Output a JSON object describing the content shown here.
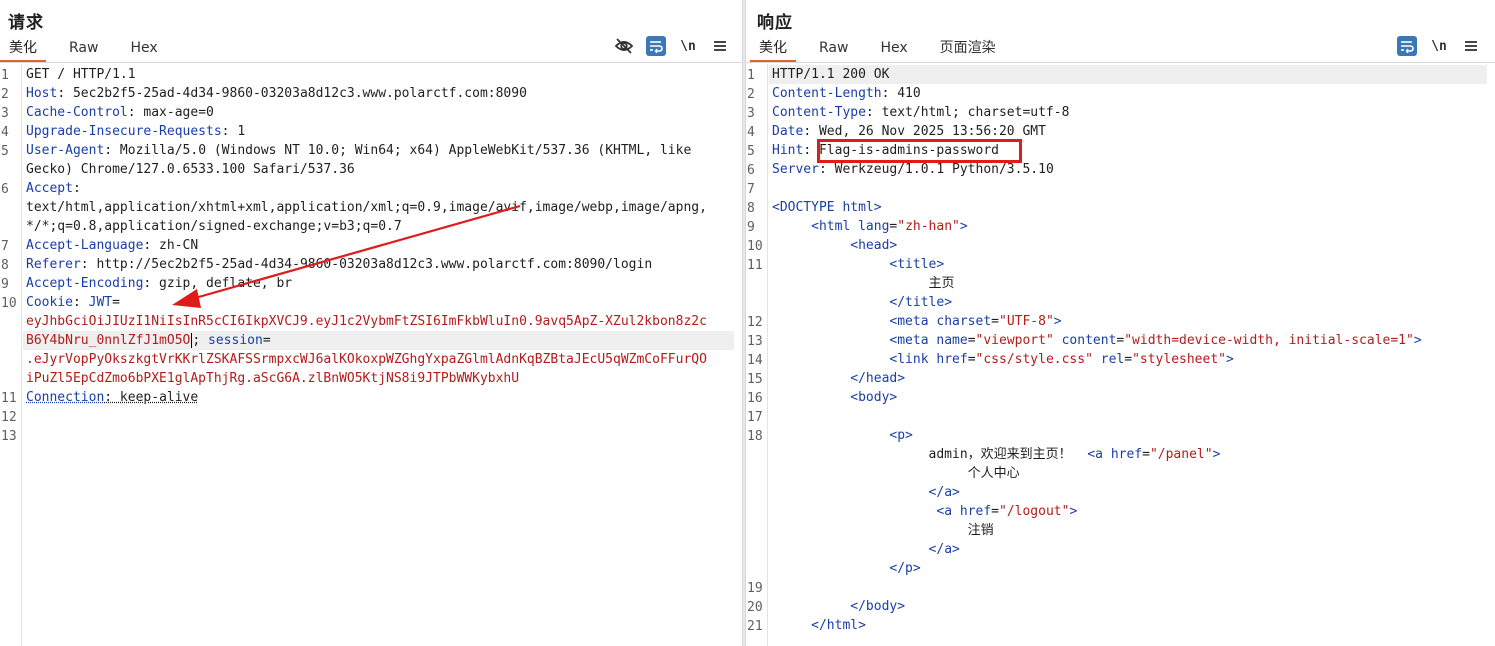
{
  "request": {
    "title": "请求",
    "tabs": [
      "美化",
      "Raw",
      "Hex"
    ],
    "newline_label": "\\n",
    "lines": [
      {
        "n": "1",
        "parts": [
          {
            "t": "GET / HTTP/1.1",
            "c": ""
          }
        ]
      },
      {
        "n": "2",
        "parts": [
          {
            "t": "Host",
            "c": "hn"
          },
          {
            "t": ": 5ec2b2f5-25ad-4d34-9860-03203a8d12c3.www.polarctf.com:8090",
            "c": ""
          }
        ]
      },
      {
        "n": "3",
        "parts": [
          {
            "t": "Cache-Control",
            "c": "hn"
          },
          {
            "t": ": max-age=0",
            "c": ""
          }
        ]
      },
      {
        "n": "4",
        "parts": [
          {
            "t": "Upgrade-Insecure-Requests",
            "c": "hn"
          },
          {
            "t": ": 1",
            "c": ""
          }
        ]
      },
      {
        "n": "5",
        "parts": [
          {
            "t": "User-Agent",
            "c": "hn"
          },
          {
            "t": ": Mozilla/5.0 (Windows NT 10.0; Win64; x64) AppleWebKit/537.36 (KHTML, like",
            "c": ""
          }
        ]
      },
      {
        "n": "",
        "parts": [
          {
            "t": "Gecko) Chrome/127.0.6533.100 Safari/537.36",
            "c": ""
          }
        ]
      },
      {
        "n": "6",
        "parts": [
          {
            "t": "Accept",
            "c": "hn"
          },
          {
            "t": ":",
            "c": ""
          }
        ]
      },
      {
        "n": "",
        "parts": [
          {
            "t": "text/html,application/xhtml+xml,application/xml;q=0.9,image/avif,image/webp,image/apng,",
            "c": ""
          }
        ]
      },
      {
        "n": "",
        "parts": [
          {
            "t": "*/*;q=0.8,application/signed-exchange;v=b3;q=0.7",
            "c": ""
          }
        ]
      },
      {
        "n": "7",
        "parts": [
          {
            "t": "Accept-Language",
            "c": "hn"
          },
          {
            "t": ": zh-CN",
            "c": ""
          }
        ]
      },
      {
        "n": "8",
        "parts": [
          {
            "t": "Referer",
            "c": "hn"
          },
          {
            "t": ": http://5ec2b2f5-25ad-4d34-9860-03203a8d12c3.www.polarctf.com:8090/login",
            "c": ""
          }
        ]
      },
      {
        "n": "9",
        "parts": [
          {
            "t": "Accept-Encoding",
            "c": "hn"
          },
          {
            "t": ": gzip, deflate, br",
            "c": ""
          }
        ]
      },
      {
        "n": "10",
        "parts": [
          {
            "t": "Cookie",
            "c": "hn"
          },
          {
            "t": ": ",
            "c": ""
          },
          {
            "t": "JWT",
            "c": "hn"
          },
          {
            "t": "=",
            "c": ""
          }
        ]
      },
      {
        "n": "",
        "parts": [
          {
            "t": "eyJhbGciOiJIUzI1NiIsInR5cCI6IkpXVCJ9.eyJ1c2VybmFtZSI6ImFkbWluIn0.9avq5ApZ-XZul2kbon8z2c",
            "c": "rv"
          }
        ]
      },
      {
        "n": "",
        "hl": true,
        "parts": [
          {
            "t": "B6Y4bNru_0nnlZfJ1mO5O",
            "c": "rv"
          },
          {
            "t": "",
            "c": "cursor"
          },
          {
            "t": "; ",
            "c": ""
          },
          {
            "t": "session",
            "c": "hn"
          },
          {
            "t": "=",
            "c": ""
          }
        ]
      },
      {
        "n": "",
        "parts": [
          {
            "t": ".eJyrVopPyOkszkgtVrKKrlZSKAFSSrmpxcWJ6alKOkoxpWZGhgYxpaZGlmlAdnKqBZBtaJEcU5qWZmCoFFurQO",
            "c": "rv"
          }
        ]
      },
      {
        "n": "",
        "parts": [
          {
            "t": "iPuZl5EpCdZmo6bPXE1glApThjRg.aScG6A.zlBnWO5KtjNS8i9JTPbWWKybxhU",
            "c": "rv"
          }
        ]
      },
      {
        "n": "11",
        "parts": [
          {
            "t": "Connection",
            "c": "hn underline"
          },
          {
            "t": ": keep-alive",
            "c": "underline"
          }
        ]
      },
      {
        "n": "12",
        "parts": []
      },
      {
        "n": "13",
        "parts": []
      }
    ]
  },
  "response": {
    "title": "响应",
    "tabs": [
      "美化",
      "Raw",
      "Hex",
      "页面渲染"
    ],
    "newline_label": "\\n",
    "lines": [
      {
        "n": "1",
        "hl": true,
        "parts": [
          {
            "t": "HTTP/1.1 200 OK",
            "c": ""
          }
        ]
      },
      {
        "n": "2",
        "parts": [
          {
            "t": "Content-Length",
            "c": "hn"
          },
          {
            "t": ": 410",
            "c": ""
          }
        ]
      },
      {
        "n": "3",
        "parts": [
          {
            "t": "Content-Type",
            "c": "hn"
          },
          {
            "t": ": text/html; charset=utf-8",
            "c": ""
          }
        ]
      },
      {
        "n": "4",
        "parts": [
          {
            "t": "Date",
            "c": "hn"
          },
          {
            "t": ": Wed, 26 Nov 2025 13:56:20 GMT",
            "c": ""
          }
        ]
      },
      {
        "n": "5",
        "parts": [
          {
            "t": "Hint",
            "c": "hn"
          },
          {
            "t": ": Flag-is-admins-password",
            "c": ""
          }
        ]
      },
      {
        "n": "6",
        "parts": [
          {
            "t": "Server",
            "c": "hn"
          },
          {
            "t": ": Werkzeug/1.0.1 Python/3.5.10",
            "c": ""
          }
        ]
      },
      {
        "n": "7",
        "parts": []
      },
      {
        "n": "8",
        "parts": [
          {
            "t": "<DOCTYPE html>",
            "c": "tag"
          }
        ]
      },
      {
        "n": "9",
        "parts": [
          {
            "t": "     ",
            "c": ""
          },
          {
            "t": "<html ",
            "c": "tag"
          },
          {
            "t": "lang",
            "c": "attr"
          },
          {
            "t": "=",
            "c": ""
          },
          {
            "t": "\"zh-han\"",
            "c": "str"
          },
          {
            "t": ">",
            "c": "tag"
          }
        ]
      },
      {
        "n": "10",
        "parts": [
          {
            "t": "          ",
            "c": ""
          },
          {
            "t": "<head>",
            "c": "tag"
          }
        ]
      },
      {
        "n": "11",
        "parts": [
          {
            "t": "               ",
            "c": ""
          },
          {
            "t": "<title>",
            "c": "tag"
          }
        ]
      },
      {
        "n": "",
        "parts": [
          {
            "t": "                    主页",
            "c": ""
          }
        ]
      },
      {
        "n": "",
        "parts": [
          {
            "t": "               ",
            "c": ""
          },
          {
            "t": "</title>",
            "c": "tag"
          }
        ]
      },
      {
        "n": "12",
        "parts": [
          {
            "t": "               ",
            "c": ""
          },
          {
            "t": "<meta ",
            "c": "tag"
          },
          {
            "t": "charset",
            "c": "attr"
          },
          {
            "t": "=",
            "c": ""
          },
          {
            "t": "\"UTF-8\"",
            "c": "str"
          },
          {
            "t": ">",
            "c": "tag"
          }
        ]
      },
      {
        "n": "13",
        "parts": [
          {
            "t": "               ",
            "c": ""
          },
          {
            "t": "<meta ",
            "c": "tag"
          },
          {
            "t": "name",
            "c": "attr"
          },
          {
            "t": "=",
            "c": ""
          },
          {
            "t": "\"viewport\" ",
            "c": "str"
          },
          {
            "t": "content",
            "c": "attr"
          },
          {
            "t": "=",
            "c": ""
          },
          {
            "t": "\"width=device-width, initial-scale=1\"",
            "c": "str"
          },
          {
            "t": ">",
            "c": "tag"
          }
        ]
      },
      {
        "n": "14",
        "parts": [
          {
            "t": "               ",
            "c": ""
          },
          {
            "t": "<link ",
            "c": "tag"
          },
          {
            "t": "href",
            "c": "attr"
          },
          {
            "t": "=",
            "c": ""
          },
          {
            "t": "\"css/style.css\" ",
            "c": "str"
          },
          {
            "t": "rel",
            "c": "attr"
          },
          {
            "t": "=",
            "c": ""
          },
          {
            "t": "\"stylesheet\"",
            "c": "str"
          },
          {
            "t": ">",
            "c": "tag"
          }
        ]
      },
      {
        "n": "15",
        "parts": [
          {
            "t": "          ",
            "c": ""
          },
          {
            "t": "</head>",
            "c": "tag"
          }
        ]
      },
      {
        "n": "16",
        "parts": [
          {
            "t": "          ",
            "c": ""
          },
          {
            "t": "<body>",
            "c": "tag"
          }
        ]
      },
      {
        "n": "17",
        "parts": []
      },
      {
        "n": "18",
        "parts": [
          {
            "t": "               ",
            "c": ""
          },
          {
            "t": "<p>",
            "c": "tag"
          }
        ]
      },
      {
        "n": "",
        "parts": [
          {
            "t": "                    admin，欢迎来到主页！  ",
            "c": ""
          },
          {
            "t": "<a ",
            "c": "tag"
          },
          {
            "t": "href",
            "c": "attr"
          },
          {
            "t": "=",
            "c": ""
          },
          {
            "t": "\"/panel\"",
            "c": "str"
          },
          {
            "t": ">",
            "c": "tag"
          }
        ]
      },
      {
        "n": "",
        "parts": [
          {
            "t": "                         个人中心",
            "c": ""
          }
        ]
      },
      {
        "n": "",
        "parts": [
          {
            "t": "                    ",
            "c": ""
          },
          {
            "t": "</a>",
            "c": "tag"
          }
        ]
      },
      {
        "n": "",
        "parts": [
          {
            "t": "                     ",
            "c": ""
          },
          {
            "t": "<a ",
            "c": "tag"
          },
          {
            "t": "href",
            "c": "attr"
          },
          {
            "t": "=",
            "c": ""
          },
          {
            "t": "\"/logout\"",
            "c": "str"
          },
          {
            "t": ">",
            "c": "tag"
          }
        ]
      },
      {
        "n": "",
        "parts": [
          {
            "t": "                         注销",
            "c": ""
          }
        ]
      },
      {
        "n": "",
        "parts": [
          {
            "t": "                    ",
            "c": ""
          },
          {
            "t": "</a>",
            "c": "tag"
          }
        ]
      },
      {
        "n": "",
        "parts": [
          {
            "t": "               ",
            "c": ""
          },
          {
            "t": "</p>",
            "c": "tag"
          }
        ]
      },
      {
        "n": "19",
        "parts": []
      },
      {
        "n": "20",
        "parts": [
          {
            "t": "          ",
            "c": ""
          },
          {
            "t": "</body>",
            "c": "tag"
          }
        ]
      },
      {
        "n": "21",
        "parts": [
          {
            "t": "     ",
            "c": ""
          },
          {
            "t": "</html>",
            "c": "tag"
          }
        ]
      }
    ]
  },
  "annotations": {
    "highlight_color": "#e01b1b",
    "arrow_color": "#e01b1b"
  }
}
